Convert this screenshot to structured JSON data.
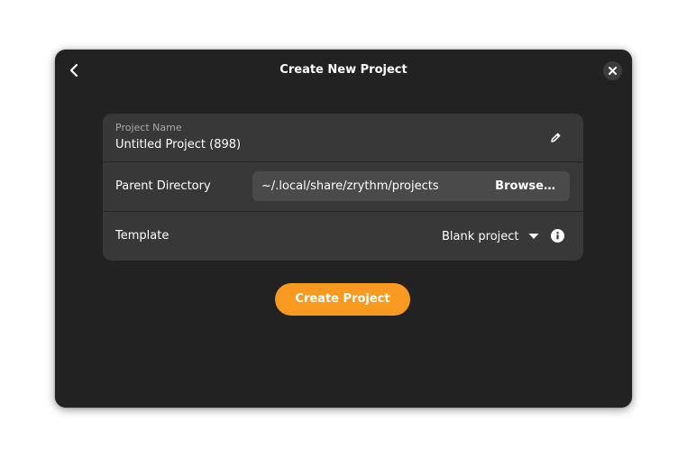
{
  "dialog": {
    "title": "Create New Project"
  },
  "form": {
    "project_name": {
      "label": "Project Name",
      "value": "Untitled Project (898)"
    },
    "parent_directory": {
      "label": "Parent Directory",
      "value": "~/.local/share/zrythm/projects",
      "browse_label": "Browse…"
    },
    "template": {
      "label": "Template",
      "selected": "Blank project"
    }
  },
  "actions": {
    "create_label": "Create Project"
  },
  "icons": {
    "back": "chevron-left-icon",
    "close": "close-icon",
    "edit": "pencil-icon",
    "dropdown": "caret-down-icon",
    "info": "info-icon"
  },
  "colors": {
    "accent": "#f79a1f",
    "dialog_bg": "#222222",
    "card_bg": "#383838",
    "field_bg": "#4a4a4a"
  }
}
